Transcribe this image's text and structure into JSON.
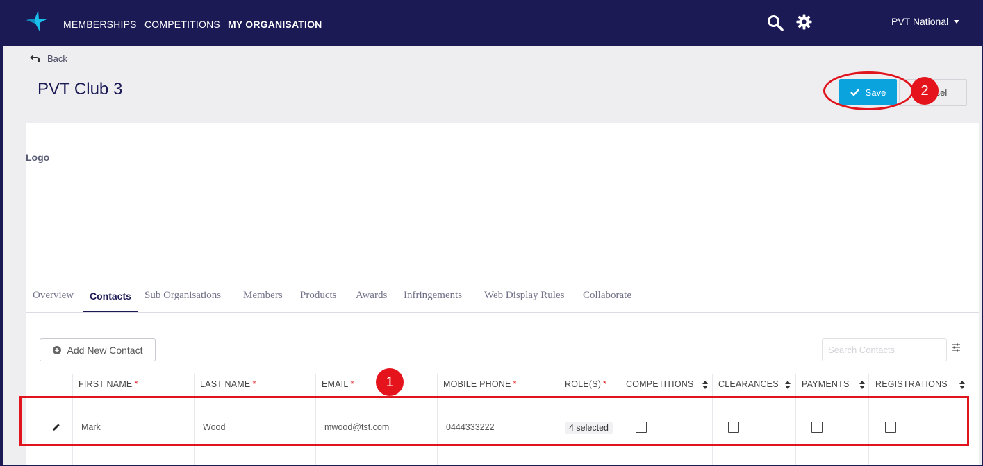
{
  "nav": {
    "items": [
      {
        "label": "MEMBERSHIPS",
        "active": false
      },
      {
        "label": "COMPETITIONS",
        "active": false
      },
      {
        "label": "MY ORGANISATION",
        "active": true
      }
    ],
    "org_selector": "PVT National",
    "icons": [
      "star-logo-icon",
      "search-icon",
      "gear-icon",
      "caret-down-icon"
    ]
  },
  "page": {
    "back_label": "Back",
    "title": "PVT Club 3",
    "save_label": "Save",
    "cancel_label": "Cancel",
    "logo_label": "Logo"
  },
  "tabs": [
    {
      "label": "Overview",
      "active": false
    },
    {
      "label": "Contacts",
      "active": true
    },
    {
      "label": "Sub Organisations",
      "active": false
    },
    {
      "label": "Members",
      "active": false
    },
    {
      "label": "Products",
      "active": false
    },
    {
      "label": "Awards",
      "active": false
    },
    {
      "label": "Infringements",
      "active": false
    },
    {
      "label": "Web Display Rules",
      "active": false
    },
    {
      "label": "Collaborate",
      "active": false
    }
  ],
  "contacts": {
    "add_label": "Add New Contact",
    "search_placeholder": "Search Contacts",
    "columns": [
      {
        "label": "FIRST NAME",
        "required": "*"
      },
      {
        "label": "LAST NAME",
        "required": "*"
      },
      {
        "label": "EMAIL",
        "required": "*"
      },
      {
        "label": "MOBILE PHONE",
        "required": "*"
      },
      {
        "label": "ROLE(S)",
        "required": "*"
      },
      {
        "label": "COMPETITIONS"
      },
      {
        "label": "CLEARANCES"
      },
      {
        "label": "PAYMENTS"
      },
      {
        "label": "REGISTRATIONS"
      }
    ],
    "rows": [
      {
        "first_name": "Mark",
        "last_name": "Wood",
        "email": "mwood@tst.com",
        "mobile": "0444333222",
        "roles": "4 selected",
        "competitions": false,
        "clearances": false,
        "payments": false,
        "registrations": false
      }
    ]
  },
  "annotations": {
    "marker_1": "1",
    "marker_2": "2"
  },
  "colors": {
    "nav_bg": "#1b1a55",
    "accent": "#0aa3dd",
    "annotation_red": "#e0141c",
    "content_bg": "#eeeef1"
  }
}
